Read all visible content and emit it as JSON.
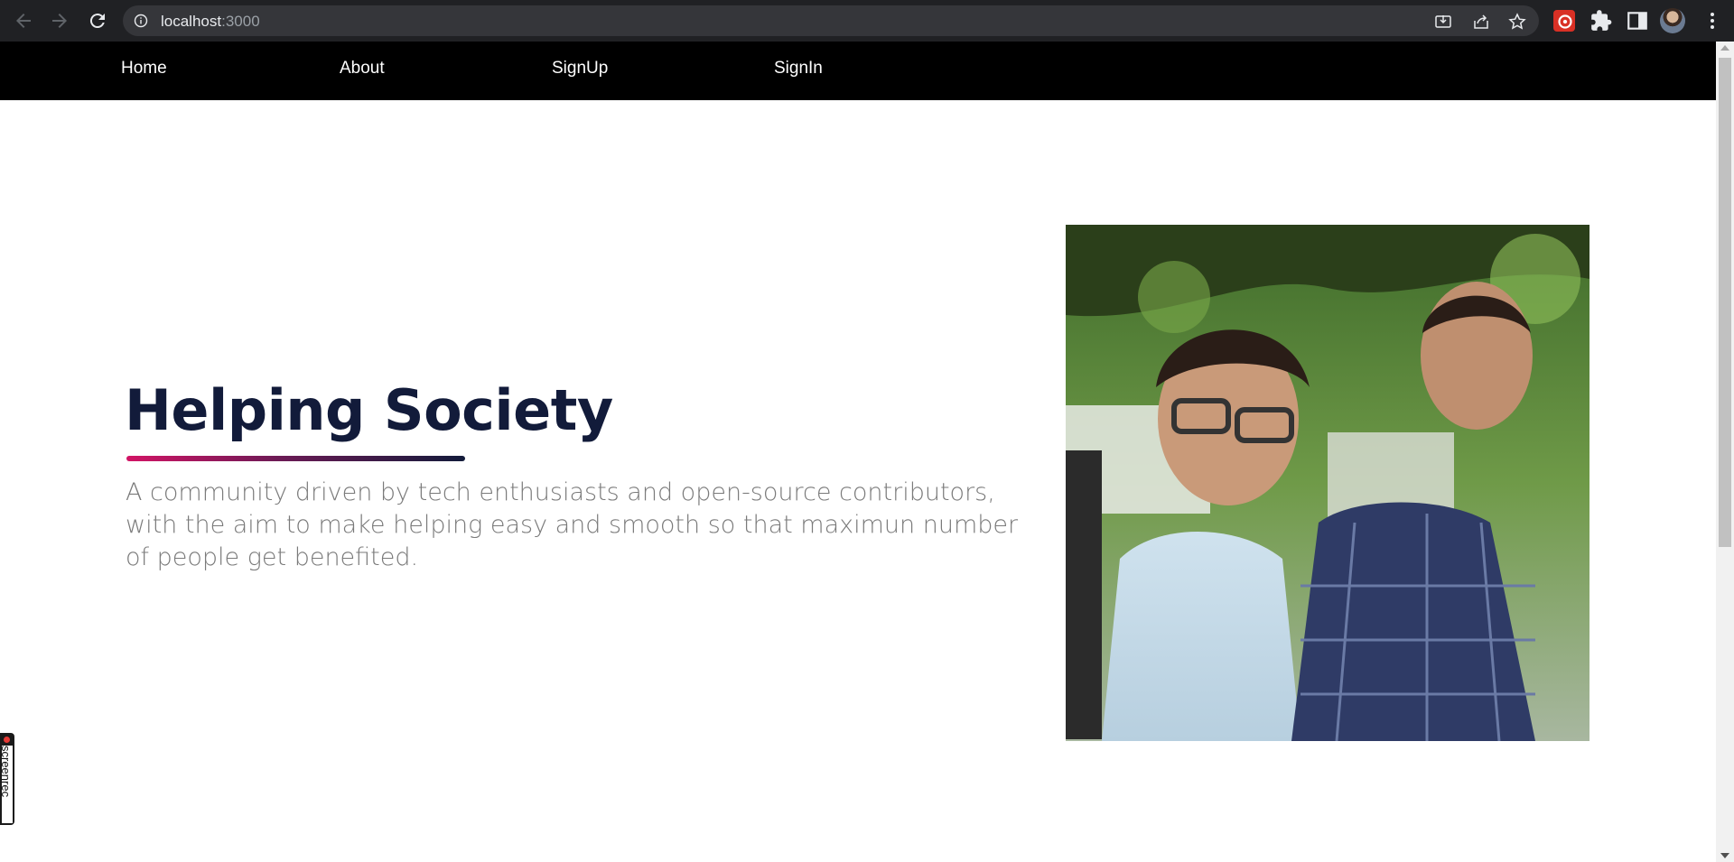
{
  "browser": {
    "url_host": "localhost",
    "url_port": ":3000",
    "icons": [
      "back-arrow-icon",
      "forward-arrow-icon",
      "reload-icon",
      "info-icon",
      "install-icon",
      "share-icon",
      "star-icon",
      "extension-icon",
      "puzzle-icon",
      "side-panel-icon",
      "profile-avatar",
      "more-vert-icon"
    ]
  },
  "nav": {
    "items": [
      {
        "label": "Home"
      },
      {
        "label": "About"
      },
      {
        "label": "SignUp"
      },
      {
        "label": "SignIn"
      }
    ]
  },
  "hero": {
    "title": "Helping Society",
    "description": "A community driven by tech enthusiasts and open-source contributors, with the aim to make helping easy and smooth so that maximun number of people get benefited."
  },
  "overlay": {
    "screenrec_label": "screenrec"
  },
  "colors": {
    "nav_bg": "#000000",
    "title": "#121b3a",
    "description": "#7a7a7a",
    "underline_start": "#d21465",
    "underline_end": "#121b3a"
  }
}
